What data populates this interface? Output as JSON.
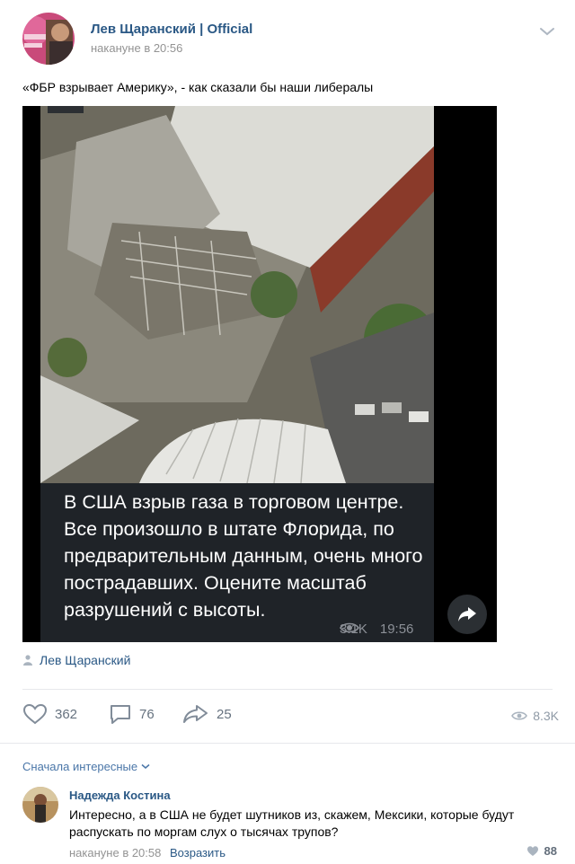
{
  "post": {
    "author": "Лев Щаранский | Official",
    "time": "накануне в 20:56",
    "text": "«ФБР взрывает Америку», - как сказали бы наши либералы",
    "signer": "Лев Щаранский"
  },
  "media": {
    "caption": "В США взрыв газа в торговом центре. Все произошло в штате Флорида, по предварительным данным, очень много пострадавших. Оцените масштаб разрушений с высоты.",
    "views": "3.1K",
    "time": "19:56"
  },
  "actions": {
    "likes": "362",
    "comments": "76",
    "shares": "25",
    "views": "8.3K"
  },
  "comments": {
    "sort_label": "Сначала интересные",
    "items": [
      {
        "author": "Надежда Костина",
        "text": "Интересно, а в США не будет шутников из, скажем, Мексики, которые будут распускать по моргам слух о тысячах трупов?",
        "time": "накануне в 20:58",
        "reply_label": "Возразить",
        "likes": "88"
      }
    ]
  },
  "colors": {
    "link": "#2a5885",
    "muted": "#939393",
    "icon": "#818c99",
    "divider": "#e7e8ec"
  },
  "icons": [
    "chevron-down-icon",
    "eye-icon",
    "share-arrow-icon",
    "person-icon",
    "heart-icon",
    "comment-icon",
    "repost-icon",
    "like-icon"
  ]
}
